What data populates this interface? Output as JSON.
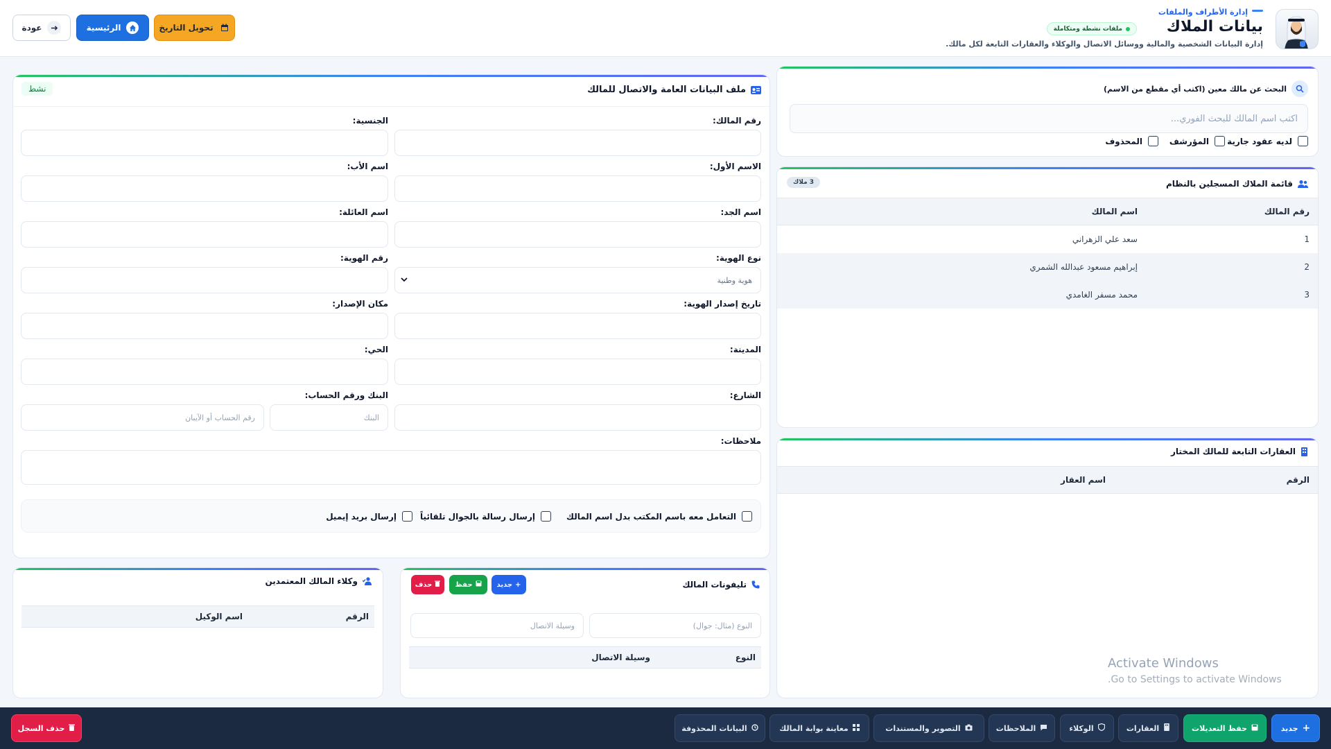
{
  "header": {
    "breadcrumb": "إدارة الأطراف والملفات",
    "title": "بيانات الملاك",
    "status_badge": "ملفات نشطة ومتكاملة",
    "subtitle": "إدارة البيانات الشخصية والمالية ووسائل الاتصال والوكلاء والعقارات التابعة لكل مالك.",
    "buttons": {
      "convert_date": "تحويل التاريخ",
      "home": "الرئيسية",
      "back": "عودة"
    }
  },
  "search": {
    "title": "البحث عن مالك معين (اكتب أي مقطع من الاسم)",
    "placeholder": "اكتب اسم المالك للبحث الفوري...",
    "filters": [
      "لديه عقود جارية",
      "المؤرشف",
      "المحذوف"
    ]
  },
  "owners_list": {
    "title": "قائمة الملاك المسجلين بالنظام",
    "count_badge": "3 ملاك",
    "columns": [
      "رقم المالك",
      "اسم المالك"
    ],
    "rows": [
      {
        "id": "1",
        "name": "سعد علي الزهراني"
      },
      {
        "id": "2",
        "name": "إبراهيم مسعود عبدالله الشمري"
      },
      {
        "id": "3",
        "name": "محمد مسفر الغامدي"
      }
    ]
  },
  "properties": {
    "title": "العقارات التابعة للمالك المختار",
    "columns": [
      "الرقم",
      "اسم العقار"
    ]
  },
  "profile": {
    "title": "ملف البيانات العامة والاتصال للمالك",
    "status": "نشط",
    "fields": {
      "owner_no": "رقم المالك:",
      "nationality": "الجنسية:",
      "first_name": "الاسم الأول:",
      "father_name": "اسم الأب:",
      "grandfather_name": "اسم الجد:",
      "family_name": "اسم العائلة:",
      "id_type": "نوع الهوية:",
      "id_type_value": "هوية وطنية",
      "id_no": "رقم الهوية:",
      "id_issue_date": "تاريخ إصدار الهوية:",
      "issue_place": "مكان الإصدار:",
      "city": "المدينة:",
      "district": "الحي:",
      "street": "الشارع:",
      "bank_account": "البنك ورقم الحساب:",
      "bank_placeholder": "البنك",
      "account_placeholder": "رقم الحساب أو الآيبان",
      "notes": "ملاحظات:"
    },
    "options": [
      "التعامل معه باسم المكتب بدل اسم المالك",
      "إرسال رسالة بالجوال تلقائياً",
      "إرسال بريد إيميل"
    ]
  },
  "phones": {
    "title": "تليفونات المالك",
    "buttons": {
      "new": "جديد",
      "save": "حفظ",
      "delete": "حذف"
    },
    "type_placeholder": "النوع (مثال: جوال)",
    "contact_placeholder": "وسيلة الاتصال",
    "columns": [
      "النوع",
      "وسيلة الاتصال"
    ]
  },
  "agents": {
    "title": "وكلاء المالك المعتمدين",
    "columns": [
      "الرقم",
      "اسم الوكيل"
    ]
  },
  "footer": {
    "new": "جديد",
    "save": "حفظ التعديلات",
    "properties": "العقارات",
    "agents": "الوكلاء",
    "notes": "الملاحظات",
    "docs": "التصوير والمستندات",
    "portal": "معاينة بوابة المالك",
    "deleted": "البيانات المحذوفة",
    "delete_record": "حذف السجل"
  },
  "watermark": {
    "line1": "Activate Windows",
    "line2": "Go to Settings to activate Windows."
  },
  "colors": {
    "primary": "#1e6fe0",
    "warning": "#f5a623",
    "success": "#0ea46c",
    "danger": "#e11d48",
    "footer_bg": "#1b2a41"
  }
}
